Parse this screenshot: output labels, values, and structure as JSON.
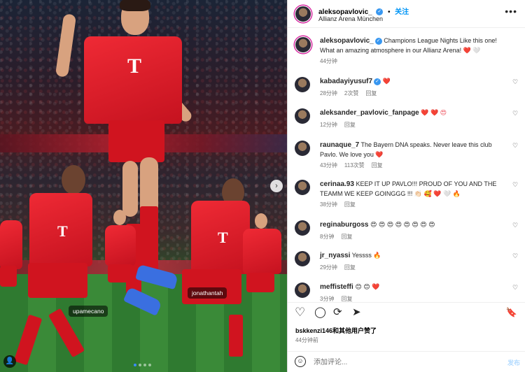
{
  "header": {
    "username": "aleksopavlovic_",
    "verified_glyph": "✓",
    "follow_label": "关注",
    "location": "Allianz Arena München",
    "more_glyph": "•••"
  },
  "media": {
    "tags": [
      "upamecano",
      "jonathantah"
    ],
    "next_glyph": "›",
    "user_icon_glyph": "👤",
    "carousel_count": 4,
    "carousel_active": 0
  },
  "caption": {
    "username": "aleksopavlovic_",
    "text": "Champions League Nights Like this one! What an amazing atmosphere in our Allianz Arena! ❤️ 🤍",
    "time": "44分钟"
  },
  "comments": [
    {
      "username": "kabadayiyusuf7",
      "verified": true,
      "text": "❤️",
      "time": "28分钟",
      "likes": "2次赞",
      "reply": "回复"
    },
    {
      "username": "aleksander_pavlovic_fanpage",
      "verified": false,
      "text": "❤️ ❤️ 😍",
      "time": "12分钟",
      "likes": "",
      "reply": "回复"
    },
    {
      "username": "raunaque_7",
      "verified": false,
      "text": "The Bayern DNA speaks. Never leave this club Pavlo. We love you ❤️",
      "time": "43分钟",
      "likes": "113次赞",
      "reply": "回复"
    },
    {
      "username": "cerinaa.93",
      "verified": false,
      "text": "KEEP IT UP PAVLO!!! PROUD OF YOU AND THE TEAMM WE KEEP GOINGGG !!! 👏🏻 🥰 ❤️ 🤍 🔥",
      "time": "38分钟",
      "likes": "",
      "reply": "回复"
    },
    {
      "username": "reginaburgoss",
      "verified": false,
      "text": "😍 😍 😍 😍 😍 😍 😍 😍",
      "time": "8分钟",
      "likes": "",
      "reply": "回复"
    },
    {
      "username": "jr_nyassi",
      "verified": false,
      "text": "Yessss 🔥",
      "time": "29分钟",
      "likes": "",
      "reply": "回复"
    },
    {
      "username": "meffisteffi",
      "verified": false,
      "text": "😊 😊 ❤️",
      "time": "3分钟",
      "likes": "",
      "reply": "回复"
    }
  ],
  "actions": {
    "like_glyph": "♡",
    "comment_glyph": "◯",
    "share_glyph": "⟳",
    "send_glyph": "➤",
    "save_glyph": "🔖"
  },
  "likes_line": "bskkenzi146和其他用户赞了",
  "post_time": "44分钟前",
  "composer": {
    "emoji_glyph": "☺",
    "placeholder": "添加评论...",
    "post_label": "发布"
  },
  "colors": {
    "accent": "#0095f6",
    "verified": "#3897f0",
    "kit_red": "#dc1e2a",
    "heart_red": "#ed4956"
  }
}
